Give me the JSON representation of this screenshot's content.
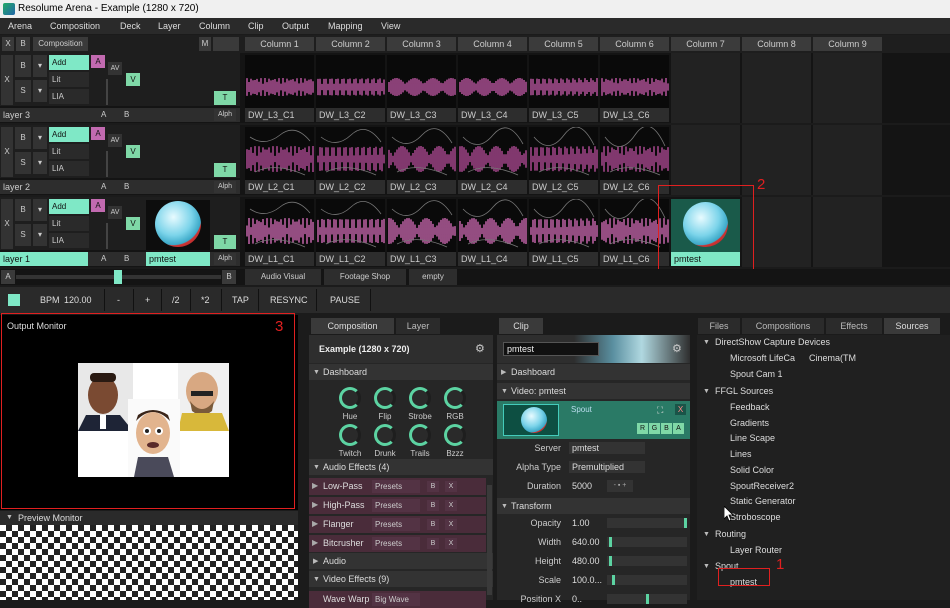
{
  "window": {
    "title": "Resolume Arena - Example (1280 x 720)"
  },
  "menu": [
    "Arena",
    "Composition",
    "Deck",
    "Layer",
    "Column",
    "Clip",
    "Output",
    "Mapping",
    "View"
  ],
  "composition_header": {
    "x": "X",
    "b": "B",
    "composition": "Composition",
    "m": "M"
  },
  "columns": [
    "Column 1",
    "Column 2",
    "Column 3",
    "Column 4",
    "Column 5",
    "Column 6",
    "Column 7",
    "Column 8",
    "Column 9"
  ],
  "layers": [
    {
      "name": "layer 3",
      "blend": "Add",
      "opt2": "Lit",
      "opt3": "LIA",
      "x": "X",
      "b": "B",
      "s": "S",
      "a_btn": "A",
      "av": "AV",
      "v": "V",
      "t": "T",
      "alph": "Alph",
      "ab_a": "A",
      "ab_b": "B",
      "clips": [
        "DW_L3_C1",
        "DW_L3_C2",
        "DW_L3_C3",
        "DW_L3_C4",
        "DW_L3_C5",
        "DW_L3_C6"
      ]
    },
    {
      "name": "layer 2",
      "blend": "Add",
      "opt2": "Lit",
      "opt3": "LIA",
      "x": "X",
      "b": "B",
      "s": "S",
      "a_btn": "A",
      "av": "AV",
      "v": "V",
      "t": "T",
      "alph": "Alph",
      "ab_a": "A",
      "ab_b": "B",
      "clips": [
        "DW_L2_C1",
        "DW_L2_C2",
        "DW_L2_C3",
        "DW_L2_C4",
        "DW_L2_C5",
        "DW_L2_C6"
      ]
    },
    {
      "name": "layer 1",
      "blend": "Add",
      "opt2": "Lit",
      "opt3": "LIA",
      "x": "X",
      "b": "B",
      "s": "S",
      "a_btn": "A",
      "av": "AV",
      "v": "V",
      "t": "T",
      "alph": "Alph",
      "ab_a": "A",
      "ab_b": "B",
      "preview_clip": "pmtest",
      "clips": [
        "DW_L1_C1",
        "DW_L1_C2",
        "DW_L1_C3",
        "DW_L1_C4",
        "DW_L1_C5",
        "DW_L1_C6",
        "pmtest"
      ]
    }
  ],
  "deck": {
    "a": "A",
    "b": "B",
    "tabs": [
      "Audio Visual",
      "Footage Shop",
      "empty"
    ]
  },
  "transport": {
    "bpm_label": "BPM",
    "bpm": "120.00",
    "minus": "-",
    "plus": "+",
    "div2": "/2",
    "mul2": "*2",
    "tap": "TAP",
    "resync": "RESYNC",
    "pause": "PAUSE"
  },
  "output_monitor": {
    "title": "Output Monitor"
  },
  "preview_monitor": {
    "title": "Preview Monitor"
  },
  "annotations": [
    "1",
    "2",
    "3"
  ],
  "composition_panel": {
    "tabs": [
      "Composition",
      "Layer"
    ],
    "title": "Example (1280 x 720)",
    "dashboard": "Dashboard",
    "knobs": [
      "Hue",
      "Flip",
      "Strobe",
      "RGB",
      "Twitch",
      "Drunk",
      "Trails",
      "Bzzz"
    ],
    "audio_effects": "Audio Effects (4)",
    "effects": [
      {
        "name": "Low-Pass",
        "presets": "Presets"
      },
      {
        "name": "High-Pass",
        "presets": "Presets"
      },
      {
        "name": "Flanger",
        "presets": "Presets"
      },
      {
        "name": "Bitcrusher",
        "presets": "Presets"
      }
    ],
    "fx_b": "B",
    "fx_x": "X",
    "audio": "Audio",
    "video_effects": "Video Effects (9)",
    "next_effect": "Wave Warp",
    "next_preset": "Big Wave"
  },
  "clip_panel": {
    "tab": "Clip",
    "clip_name": "pmtest",
    "dashboard": "Dashboard",
    "video_header": "Video: pmtest",
    "source_label": "Spout",
    "rgba": [
      "R",
      "G",
      "B",
      "A"
    ],
    "x": "X",
    "server_label": "Server",
    "server_value": "pmtest",
    "alpha_label": "Alpha Type",
    "alpha_value": "Premultiplied",
    "duration_label": "Duration",
    "duration_value": "5000",
    "transform": "Transform",
    "params": [
      {
        "label": "Opacity",
        "value": "1.00",
        "fill": 1.0
      },
      {
        "label": "Width",
        "value": "640.00",
        "fill": 0.03
      },
      {
        "label": "Height",
        "value": "480.00",
        "fill": 0.03
      },
      {
        "label": "Scale",
        "value": "100.0...",
        "fill": 0.06
      },
      {
        "label": "Position X",
        "value": "0..",
        "fill": 0.5
      }
    ]
  },
  "sources_panel": {
    "tabs": [
      "Files",
      "Compositions",
      "Effects",
      "Sources"
    ],
    "groups": [
      {
        "title": "DirectShow Capture Devices",
        "items": [
          "Microsoft LifeCa",
          "Cinema(TM",
          "Spout Cam 1"
        ]
      },
      {
        "title": "FFGL Sources",
        "items": [
          "Feedback",
          "Gradients",
          "Line Scape",
          "Lines",
          "Solid Color",
          "SpoutReceiver2",
          "Static Generator",
          "Stroboscope"
        ]
      },
      {
        "title": "Routing",
        "items": [
          "Layer Router"
        ]
      },
      {
        "title": "Spout",
        "items": [
          "pmtest"
        ]
      }
    ]
  },
  "colors": {
    "accent": "#7fe8c6",
    "pink": "#c26ab0",
    "annotation": "#e02020",
    "knob": "#5cd3a2"
  }
}
